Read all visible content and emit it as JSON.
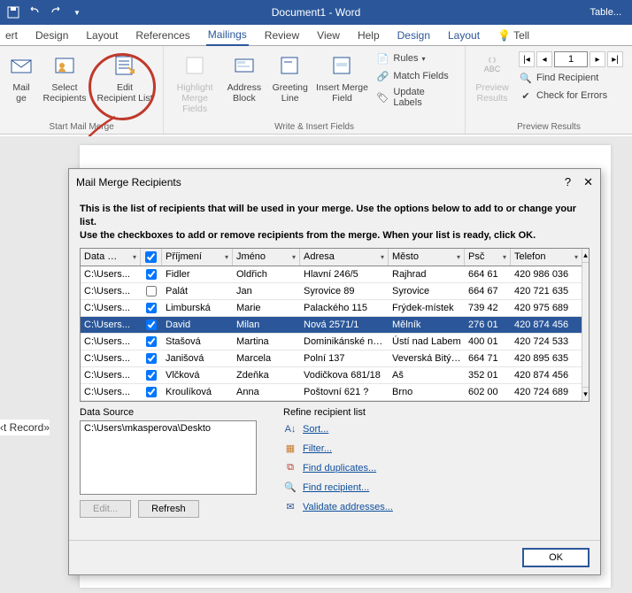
{
  "title": "Document1 - Word",
  "table_tool": "Table...",
  "tabs": {
    "ert": "ert",
    "design": "Design",
    "layout": "Layout",
    "references": "References",
    "mailings": "Mailings",
    "review": "Review",
    "view": "View",
    "help": "Help",
    "design2": "Design",
    "layout2": "Layout",
    "tell": "Tell"
  },
  "ribbon": {
    "mail_ge": "Mail\nge",
    "select_recipients": "Select\nRecipients",
    "edit_recipient_list": "Edit\nRecipient List",
    "group_start": "Start Mail Merge",
    "highlight": "Highlight\nMerge Fields",
    "address_block": "Address\nBlock",
    "greeting_line": "Greeting\nLine",
    "insert_merge_field": "Insert Merge\nField",
    "rules": "Rules",
    "match_fields": "Match Fields",
    "update_labels": "Update Labels",
    "group_write": "Write & Insert Fields",
    "abc": "ABC",
    "preview": "Preview\nResults",
    "record_value": "1",
    "find_recipient": "Find Recipient",
    "check_errors": "Check for Errors",
    "group_preview": "Preview Results"
  },
  "left_frag": "‹t Record»",
  "dialog": {
    "title": "Mail Merge Recipients",
    "desc_line1": "This is the list of recipients that will be used in your merge.  Use the options below to add to or change your list.",
    "desc_line2": "Use the checkboxes to add or remove recipients from the merge.  When your list is ready, click OK.",
    "cols": {
      "src": "Data …",
      "prijmeni": "Příjmení",
      "jmeno": "Jméno",
      "adresa": "Adresa",
      "mesto": "Město",
      "psc": "Psč",
      "telefon": "Telefon"
    },
    "rows": [
      {
        "src": "C:\\Users...",
        "chk": true,
        "p": "Fidler",
        "j": "Oldřich",
        "a": "Hlavní 246/5",
        "m": "Rajhrad",
        "psc": "664 61",
        "t": "420 986 036"
      },
      {
        "src": "C:\\Users...",
        "chk": false,
        "p": "Palát",
        "j": "Jan",
        "a": "Syrovice 89",
        "m": "Syrovice",
        "psc": "664 67",
        "t": "420 721 635"
      },
      {
        "src": "C:\\Users...",
        "chk": true,
        "p": "Limburská",
        "j": "Marie",
        "a": "Palackého 115",
        "m": "Frýdek-místek",
        "psc": "739 42",
        "t": "420 975 689"
      },
      {
        "src": "C:\\Users...",
        "chk": true,
        "p": "David",
        "j": "Milan",
        "a": "Nová 2571/1",
        "m": "Mělník",
        "psc": "276 01",
        "t": "420 874 456",
        "selected": true
      },
      {
        "src": "C:\\Users...",
        "chk": true,
        "p": "Stašová",
        "j": "Martina",
        "a": "Dominikánské n…",
        "m": "Ústí nad Labem",
        "psc": "400 01",
        "t": "420 724 533"
      },
      {
        "src": "C:\\Users...",
        "chk": true,
        "p": "Janišová",
        "j": "Marcela",
        "a": "Polní 137",
        "m": "Veverská Bitýš…",
        "psc": "664 71",
        "t": "420 895 635"
      },
      {
        "src": "C:\\Users...",
        "chk": true,
        "p": "Vlčková",
        "j": "Zdeňka",
        "a": "Vodičkova 681/18",
        "m": "Aš",
        "psc": "352 01",
        "t": "420 874 456"
      },
      {
        "src": "C:\\Users...",
        "chk": true,
        "p": "Kroulíková",
        "j": "Anna",
        "a": "Poštovní 621 ?",
        "m": "Brno",
        "psc": "602 00",
        "t": "420 724 689"
      }
    ],
    "data_source_label": "Data Source",
    "data_source_path": "C:\\Users\\mkasperova\\Deskto",
    "edit_btn": "Edit...",
    "refresh_btn": "Refresh",
    "refine_label": "Refine recipient list",
    "refine": {
      "sort": "Sort...",
      "filter": "Filter...",
      "dups": "Find duplicates...",
      "find": "Find recipient...",
      "validate": "Validate addresses..."
    },
    "ok": "OK"
  }
}
